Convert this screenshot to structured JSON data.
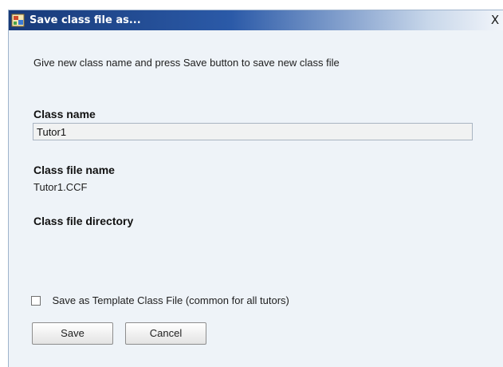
{
  "window": {
    "title": "Save class file as...",
    "close_glyph": "X",
    "title_icon": "app-icon"
  },
  "instructions": "Give new class name and press Save button to save new class file",
  "class_name": {
    "label": "Class name",
    "value": "Tutor1"
  },
  "class_file_name": {
    "label": "Class file name",
    "value": "Tutor1.CCF"
  },
  "class_file_directory": {
    "label": "Class file directory"
  },
  "template_option": {
    "label": "Save as Template Class File (common for all tutors)",
    "checked": false
  },
  "buttons": {
    "save": "Save",
    "cancel": "Cancel"
  }
}
